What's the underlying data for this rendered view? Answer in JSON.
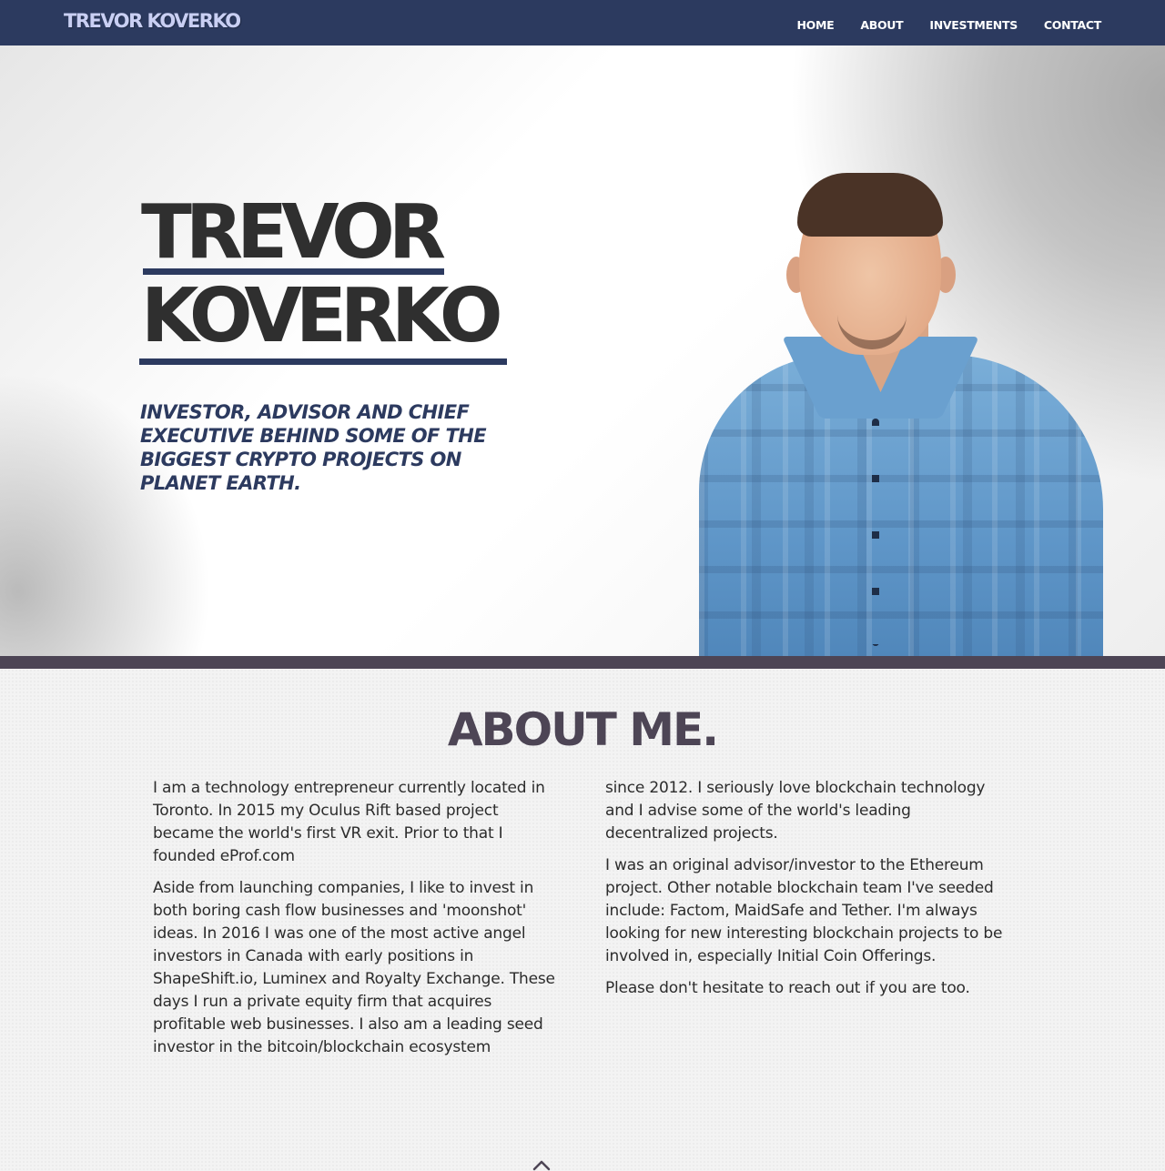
{
  "nav": {
    "brand": "TREVOR KOVERKO",
    "items": [
      "HOME",
      "ABOUT",
      "INVESTMENTS",
      "CONTACT"
    ]
  },
  "hero": {
    "name_line1": "TREVOR",
    "name_line2": "KOVERKO",
    "tagline": "INVESTOR, ADVISOR AND CHIEF EXECUTIVE BEHIND SOME OF THE BIGGEST CRYPTO PROJECTS ON PLANET EARTH."
  },
  "about": {
    "title": "ABOUT ME.",
    "left_paragraphs": [
      "I am a technology entrepreneur currently located in Toronto. In 2015 my Oculus Rift based project became the world's first VR exit. Prior to that I founded eProf.com",
      "Aside from launching companies, I like to invest in both boring cash flow businesses and 'moonshot' ideas. In 2016 I was one of the most active angel investors in Canada with early positions in ShapeShift.io, Luminex and Royalty Exchange. These days I run a private equity firm that acquires profitable web businesses. I also am a leading seed investor in the bitcoin/blockchain ecosystem"
    ],
    "right_paragraphs": [
      "since 2012. I seriously love blockchain technology and I advise some of the world's leading decentralized projects.",
      "I was an original advisor/investor to the Ethereum project. Other notable blockchain team I've seeded include: Factom, MaidSafe and Tether. I'm always looking for new interesting blockchain projects to be involved in, especially Initial Coin Offerings.",
      "Please don't hesitate to reach out if you are too."
    ]
  },
  "colors": {
    "navbar": "#2c3a5f",
    "brand_text": "#c9cff3",
    "hero_title": "#2f2f2f",
    "accent": "#2c3a5f",
    "about_title": "#4d4555",
    "divider": "#4d4555"
  },
  "icons": {
    "scroll": "chevron-up-icon"
  }
}
